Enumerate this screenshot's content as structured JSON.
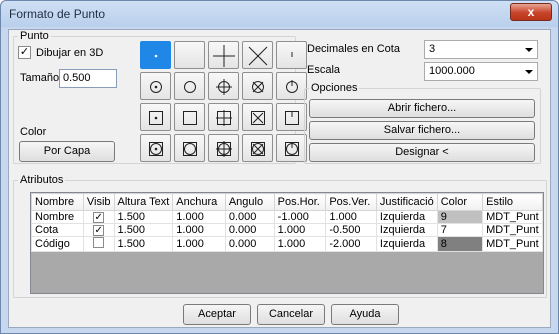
{
  "window": {
    "title": "Formato de Punto",
    "close_glyph": "x"
  },
  "punto": {
    "legend": "Punto",
    "dibujar_3d_label": "Dibujar en 3D",
    "dibujar_3d_checked": true,
    "check_glyph": "✓",
    "tamano_label": "Tamaño",
    "tamano_value": "0.500",
    "color_label": "Color",
    "por_capa_button": "Por Capa",
    "styles": [
      {
        "name": "point-style-dot",
        "inner": "dot",
        "frame": "none",
        "selected": true,
        "dot_text": "·"
      },
      {
        "name": "point-style-none",
        "inner": "none",
        "frame": "none",
        "selected": false
      },
      {
        "name": "point-style-plus",
        "inner": "plus",
        "frame": "none",
        "selected": false
      },
      {
        "name": "point-style-x",
        "inner": "x",
        "frame": "none",
        "selected": false
      },
      {
        "name": "point-style-tick",
        "inner": "tick",
        "frame": "none",
        "selected": false
      },
      {
        "name": "point-style-circle-dot",
        "inner": "dot",
        "frame": "circle",
        "selected": false
      },
      {
        "name": "point-style-circle",
        "inner": "none",
        "frame": "circle",
        "selected": false
      },
      {
        "name": "point-style-circle-plus",
        "inner": "plus",
        "frame": "circle",
        "selected": false
      },
      {
        "name": "point-style-circle-x",
        "inner": "x",
        "frame": "circle",
        "selected": false
      },
      {
        "name": "point-style-circle-tick",
        "inner": "tick",
        "frame": "circle",
        "selected": false
      },
      {
        "name": "point-style-square-dot",
        "inner": "dot",
        "frame": "square",
        "selected": false
      },
      {
        "name": "point-style-square",
        "inner": "none",
        "frame": "square",
        "selected": false
      },
      {
        "name": "point-style-square-plus",
        "inner": "plus",
        "frame": "square",
        "selected": false
      },
      {
        "name": "point-style-square-x",
        "inner": "x",
        "frame": "square",
        "selected": false
      },
      {
        "name": "point-style-square-tick",
        "inner": "tick",
        "frame": "square",
        "selected": false
      },
      {
        "name": "point-style-both-dot",
        "inner": "dot",
        "frame": "both",
        "selected": false
      },
      {
        "name": "point-style-both",
        "inner": "none",
        "frame": "both",
        "selected": false
      },
      {
        "name": "point-style-both-plus",
        "inner": "plus",
        "frame": "both",
        "selected": false
      },
      {
        "name": "point-style-both-x",
        "inner": "x",
        "frame": "both",
        "selected": false
      },
      {
        "name": "point-style-both-tick",
        "inner": "tick",
        "frame": "both",
        "selected": false
      }
    ]
  },
  "settings": {
    "decimales_label": "Decimales en Cota",
    "decimales_value": "3",
    "escala_label": "Escala",
    "escala_value": "1000.000",
    "opciones_legend": "Opciones",
    "abrir_button": "Abrir fichero...",
    "salvar_button": "Salvar fichero...",
    "designar_button": "Designar <"
  },
  "atributos": {
    "legend": "Atributos",
    "columns": [
      "Nombre",
      "Visib",
      "Altura Text",
      "Anchura",
      "Angulo",
      "Pos.Hor.",
      "Pos.Ver.",
      "Justificació",
      "Color",
      "Estilo"
    ],
    "rows": [
      {
        "nombre": "Nombre",
        "visible": true,
        "altura": "1.500",
        "anchura": "1.000",
        "angulo": "0.000",
        "pos_hor": "-1.000",
        "pos_ver": "1.000",
        "justificacion": "Izquierda",
        "color": "9",
        "color_hex": "#c0c0c0",
        "estilo": "MDT_Punt"
      },
      {
        "nombre": "Cota",
        "visible": true,
        "altura": "1.500",
        "anchura": "1.000",
        "angulo": "0.000",
        "pos_hor": "1.000",
        "pos_ver": "-0.500",
        "justificacion": "Izquierda",
        "color": "7",
        "color_hex": "#ffffff",
        "estilo": "MDT_Punt"
      },
      {
        "nombre": "Código",
        "visible": false,
        "altura": "1.500",
        "anchura": "1.000",
        "angulo": "0.000",
        "pos_hor": "1.000",
        "pos_ver": "-2.000",
        "justificacion": "Izquierda",
        "color": "8",
        "color_hex": "#808080",
        "estilo": "MDT_Punt"
      }
    ]
  },
  "footer": {
    "aceptar": "Aceptar",
    "cancelar": "Cancelar",
    "ayuda": "Ayuda"
  },
  "colors": {
    "selected": "#1f87e5",
    "title_bar": "#b9cfeb",
    "close": "#c7432a"
  }
}
